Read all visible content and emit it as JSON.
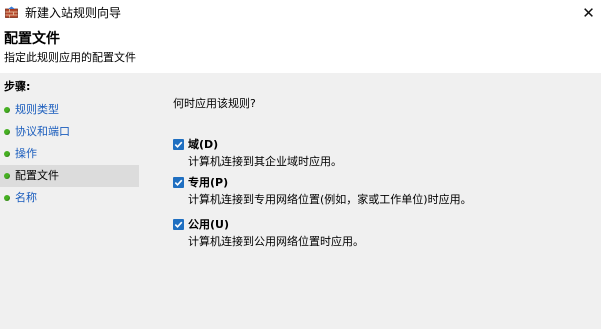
{
  "window": {
    "title": "新建入站规则向导",
    "icon": "firewall-wizard-icon",
    "close_glyph": "✕"
  },
  "header": {
    "title": "配置文件",
    "subtitle": "指定此规则应用的配置文件"
  },
  "steps": {
    "label": "步骤:",
    "items": [
      {
        "label": "规则类型",
        "current": false
      },
      {
        "label": "协议和端口",
        "current": false
      },
      {
        "label": "操作",
        "current": false
      },
      {
        "label": "配置文件",
        "current": true
      },
      {
        "label": "名称",
        "current": false
      }
    ]
  },
  "main": {
    "question": "何时应用该规则?",
    "options": [
      {
        "label": "域(D)",
        "description": "计算机连接到其企业域时应用。",
        "checked": true
      },
      {
        "label": "专用(P)",
        "description": "计算机连接到专用网络位置(例如，家或工作单位)时应用。",
        "checked": true
      },
      {
        "label": "公用(U)",
        "description": "计算机连接到公用网络位置时应用。",
        "checked": true
      }
    ]
  },
  "colors": {
    "link": "#1a5dbd",
    "checkbox": "#1f6fc1",
    "bullet": "#46b022",
    "panel": "#f0f0f0",
    "selected_step": "#dcdcdc"
  }
}
